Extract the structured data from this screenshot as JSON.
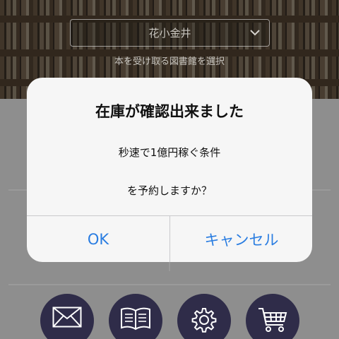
{
  "header": {
    "library_select": {
      "value": "花小金井",
      "icon": "chevron-down-icon"
    },
    "hint": "本を受け取る図書館を選択"
  },
  "alert": {
    "title": "在庫が確認出来ました",
    "line1": "秒速で1億円稼ぐ条件",
    "line2": "を予約しますか？",
    "ok_label": "OK",
    "cancel_label": "キャンセル",
    "button_color": "#2a7de1"
  },
  "bottom_nav": {
    "items": [
      {
        "icon": "mail-icon"
      },
      {
        "icon": "book-icon"
      },
      {
        "icon": "gear-icon"
      },
      {
        "icon": "cart-icon"
      }
    ],
    "button_color": "#2f2c49"
  }
}
